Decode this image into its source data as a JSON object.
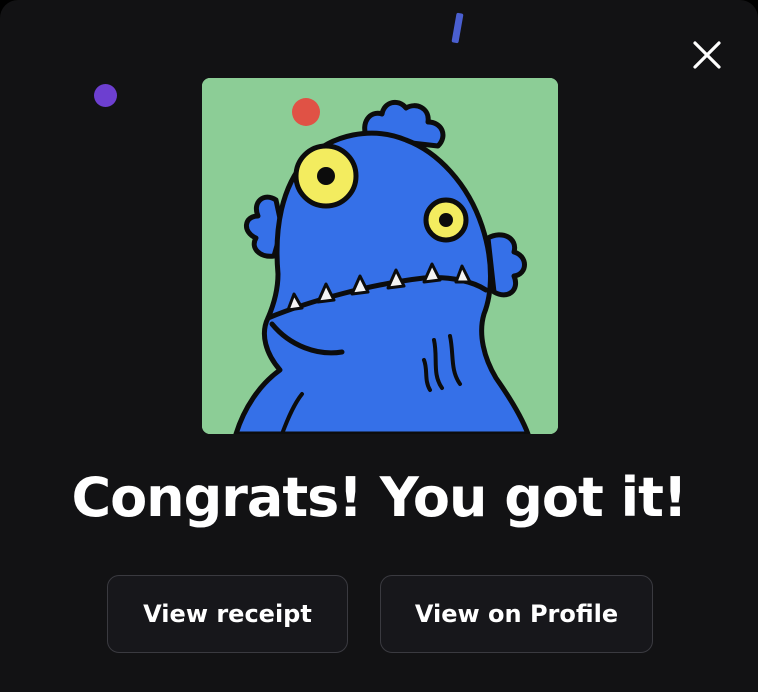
{
  "modal": {
    "headline": "Congrats! You got it!",
    "close_icon": "close-icon"
  },
  "buttons": {
    "view_receipt": "View receipt",
    "view_profile": "View on Profile"
  },
  "artwork": {
    "subject": "blue-monster-nft-artwork",
    "background_color": "#8ccd96",
    "character_color": "#3570e8",
    "eye_color": "#f3ec5f"
  },
  "confetti_colors": [
    "#6d3fd0",
    "#e05245",
    "#4a5fd0"
  ]
}
